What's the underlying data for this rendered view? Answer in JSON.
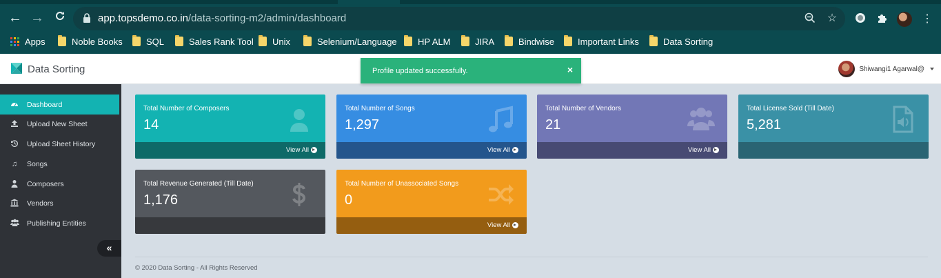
{
  "browser": {
    "url_host": "app.topsdemo.co.in",
    "url_path": "/data-sorting-m2/admin/dashboard",
    "bookmarks": [
      "Apps",
      "Noble Books",
      "SQL",
      "Sales Rank Tool",
      "Unix",
      "Selenium/Language",
      "HP ALM",
      "JIRA",
      "Bindwise",
      "Important Links",
      "Data Sorting"
    ]
  },
  "header": {
    "brand": "Data Sorting",
    "user_name": "Shiwangi1 Agarwal@"
  },
  "toast": {
    "message": "Profile updated successfully.",
    "close": "×"
  },
  "sidebar": {
    "items": [
      {
        "label": "Dashboard",
        "icon": "dashboard-icon"
      },
      {
        "label": "Upload New Sheet",
        "icon": "upload-icon"
      },
      {
        "label": "Upload Sheet History",
        "icon": "history-icon"
      },
      {
        "label": "Songs",
        "icon": "music-icon"
      },
      {
        "label": "Composers",
        "icon": "user-icon"
      },
      {
        "label": "Vendors",
        "icon": "bank-icon"
      },
      {
        "label": "Publishing Entities",
        "icon": "users-icon"
      }
    ],
    "collapse": "«"
  },
  "cards": [
    {
      "title": "Total Number of Composers",
      "value": "14",
      "link": "View All",
      "color": "#13b3b2",
      "footer_color": "#0e6a68",
      "icon": "user-icon"
    },
    {
      "title": "Total Number of Songs",
      "value": "1,297",
      "link": "View All",
      "color": "#368de2",
      "footer_color": "#24558c",
      "icon": "music-icon"
    },
    {
      "title": "Total Number of Vendors",
      "value": "21",
      "link": "View All",
      "color": "#7277b6",
      "footer_color": "#474a73",
      "icon": "users-icon"
    },
    {
      "title": "Total License Sold (Till Date)",
      "value": "5,281",
      "link": "",
      "color": "#3a91a6",
      "footer_color": "#2a6473",
      "icon": "audio-file-icon"
    },
    {
      "title": "Total Revenue Generated (Till Date)",
      "value": "1,176",
      "link": "",
      "color": "#54585e",
      "footer_color": "#37393d",
      "icon": "dollar-icon"
    },
    {
      "title": "Total Number of Unassociated Songs",
      "value": "0",
      "link": "View All",
      "color": "#f29b1c",
      "footer_color": "#955e10",
      "icon": "shuffle-icon"
    }
  ],
  "footer": {
    "text": "© 2020 Data Sorting - All Rights Reserved"
  }
}
